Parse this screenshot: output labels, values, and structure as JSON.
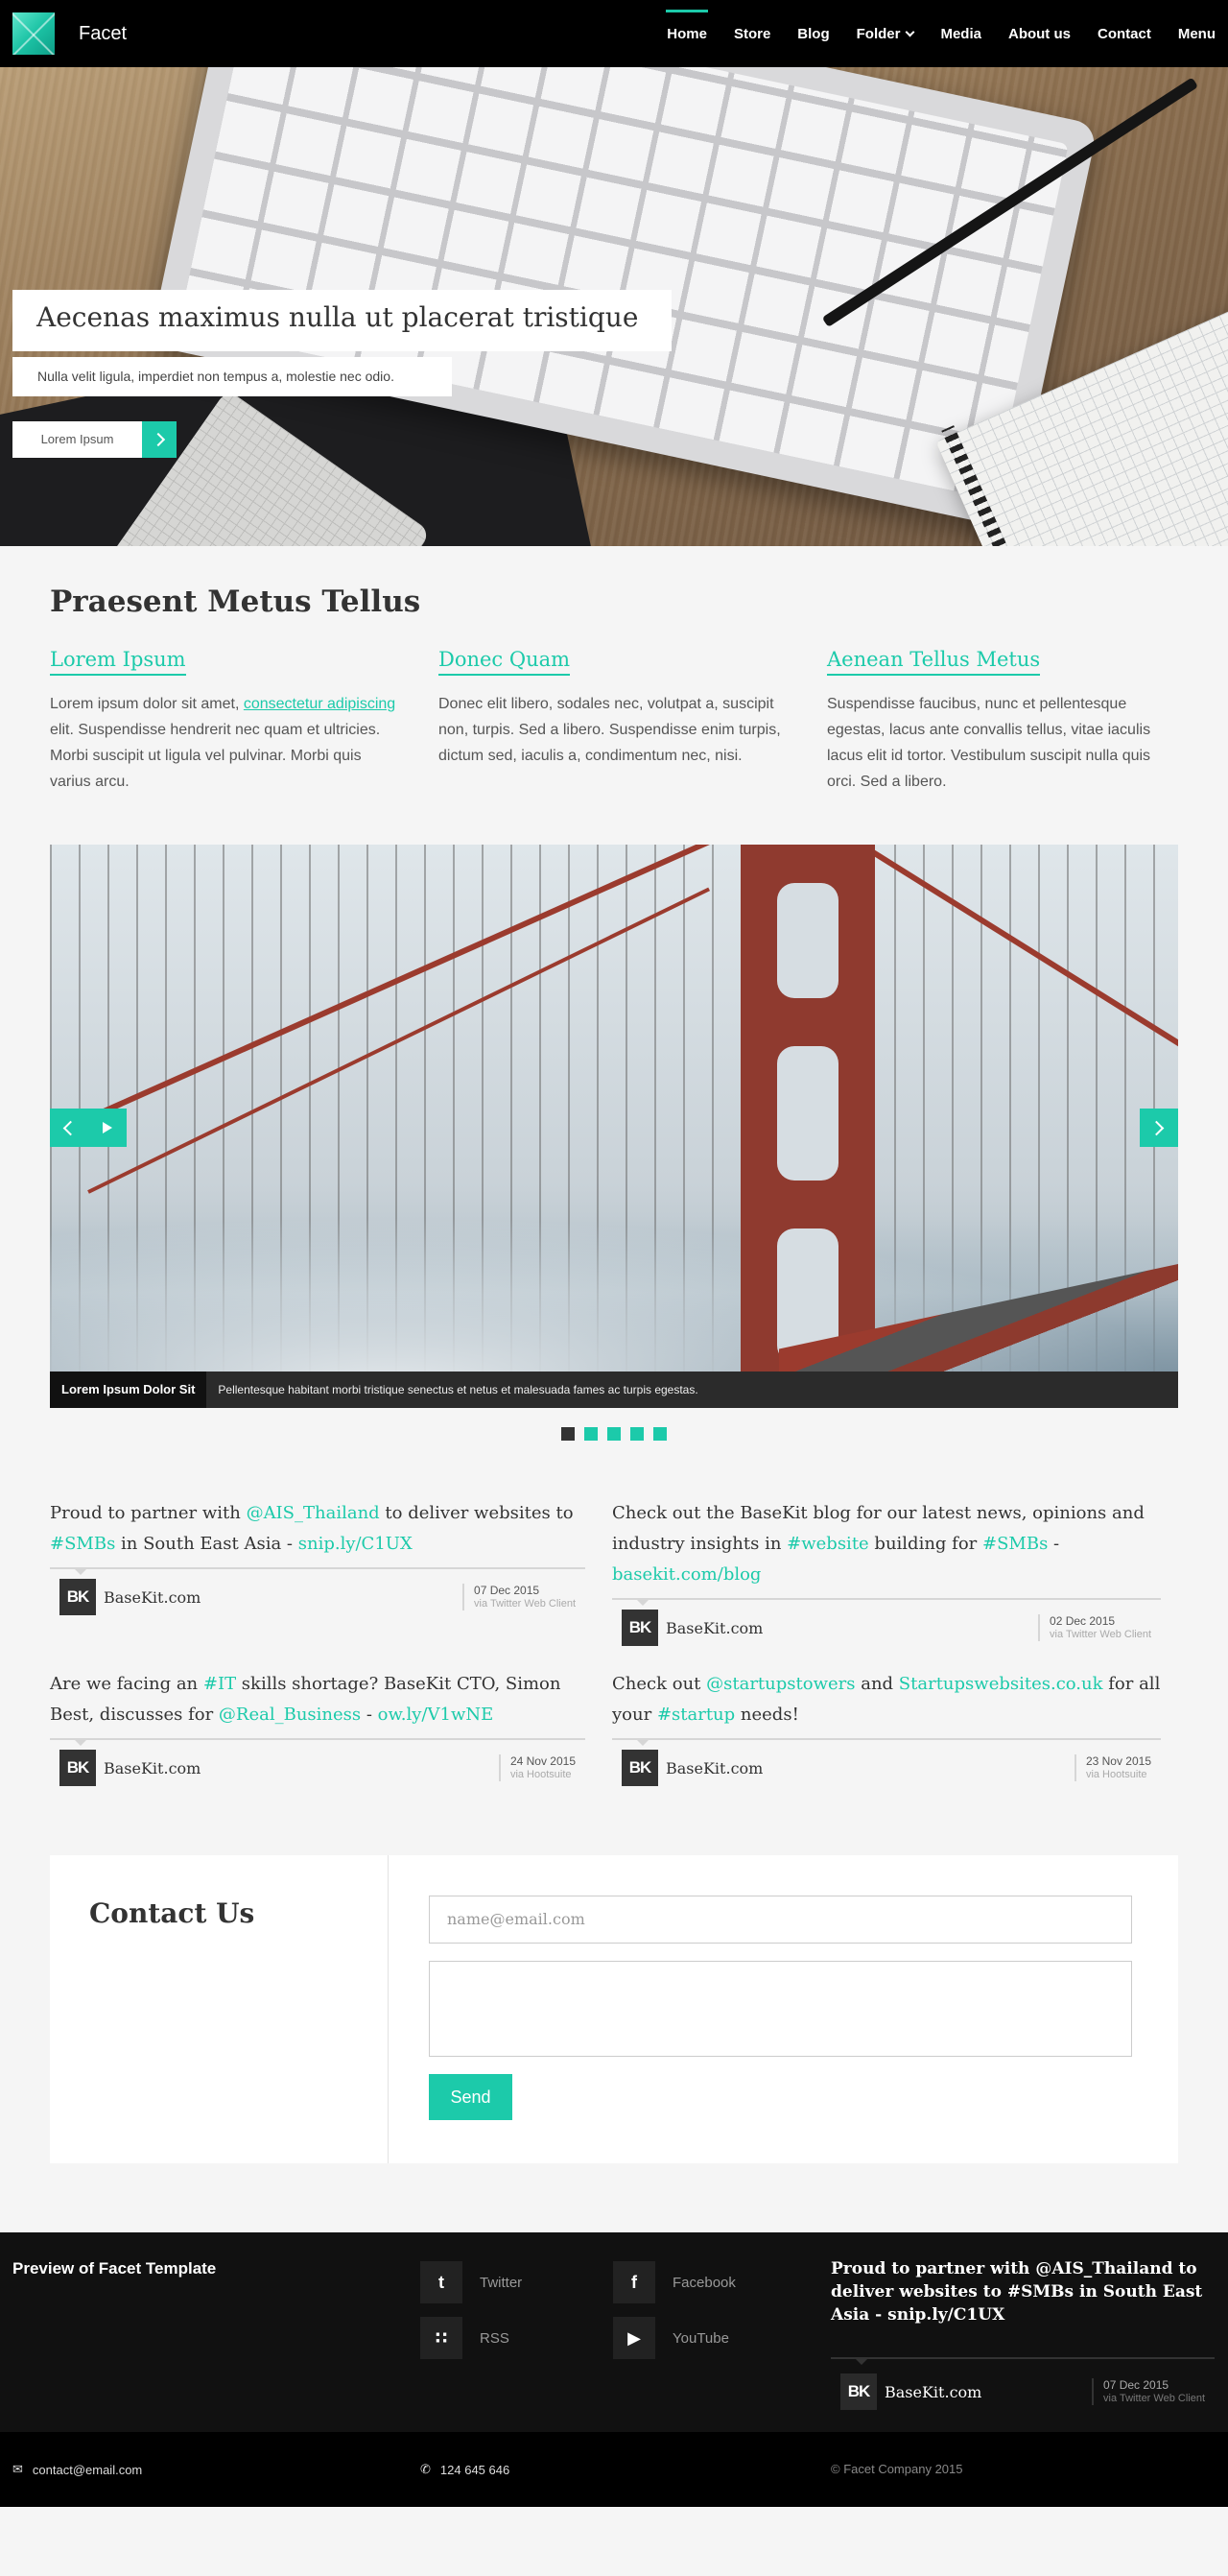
{
  "header": {
    "site_name": "Facet",
    "menu": [
      {
        "label": "Home",
        "active": true
      },
      {
        "label": "Store"
      },
      {
        "label": "Blog"
      },
      {
        "label": "Folder",
        "dropdown": true
      },
      {
        "label": "Media"
      },
      {
        "label": "About us"
      },
      {
        "label": "Contact"
      },
      {
        "label": "Menu"
      }
    ]
  },
  "hero": {
    "title": "Aecenas maximus nulla ut placerat tristique",
    "subtitle": "Nulla velit ligula, imperdiet non tempus a, molestie nec odio.",
    "button_label": "Lorem Ipsum"
  },
  "intro": {
    "title": "Praesent Metus Tellus",
    "columns": [
      {
        "title": "Lorem Ipsum",
        "text_before": "Lorem ipsum dolor sit amet, ",
        "link": "consectetur adipiscing",
        "text_after": " elit. Suspendisse hendrerit nec quam et ultricies. Morbi suscipit ut ligula vel pulvinar. Morbi quis varius arcu."
      },
      {
        "title": "Donec Quam",
        "text": "Donec elit libero, sodales nec, volutpat a, suscipit non, turpis. Sed a libero. Suspendisse enim turpis, dictum sed, iaculis a, condimentum nec, nisi."
      },
      {
        "title": "Aenean Tellus Metus",
        "text": "Suspendisse faucibus, nunc et pellentesque egestas, lacus ante convallis tellus, vitae iaculis lacus elit id tortor. Vestibulum suscipit nulla quis orci. Sed a libero."
      }
    ]
  },
  "slider": {
    "caption_title": "Lorem Ipsum Dolor Sit",
    "caption_text": "Pellentesque habitant morbi tristique senectus et netus et malesuada fames ac turpis egestas.",
    "slide_count": 5,
    "active_index": 0
  },
  "tweets": [
    {
      "parts": [
        [
          "Proud to partner with ",
          false
        ],
        [
          "@AIS_Thailand",
          true
        ],
        [
          " to deliver websites to ",
          false
        ],
        [
          "#SMBs",
          true
        ],
        [
          " in South East Asia - ",
          false
        ],
        [
          "snip.ly/C1UX",
          true
        ]
      ],
      "author": "BaseKit.com",
      "date": "07 Dec 2015",
      "via": "via Twitter Web Client"
    },
    {
      "parts": [
        [
          "Check out the BaseKit blog for our latest news, opinions and industry insights in ",
          false
        ],
        [
          "#website",
          true
        ],
        [
          " building for ",
          false
        ],
        [
          "#SMBs",
          true
        ],
        [
          " - ",
          false
        ],
        [
          "basekit.com/blog",
          true
        ]
      ],
      "author": "BaseKit.com",
      "date": "02 Dec 2015",
      "via": "via Twitter Web Client"
    },
    {
      "parts": [
        [
          "Are we facing an ",
          false
        ],
        [
          "#IT",
          true
        ],
        [
          " skills shortage? BaseKit CTO, Simon Best, discusses for ",
          false
        ],
        [
          "@Real_Business",
          true
        ],
        [
          " - ",
          false
        ],
        [
          "ow.ly/V1wNE",
          true
        ]
      ],
      "author": "BaseKit.com",
      "date": "24 Nov 2015",
      "via": "via Hootsuite"
    },
    {
      "parts": [
        [
          "Check out ",
          false
        ],
        [
          "@startupstowers",
          true
        ],
        [
          " and ",
          false
        ],
        [
          "Startupswebsites.co.uk",
          true
        ],
        [
          " for all your ",
          false
        ],
        [
          "#startup",
          true
        ],
        [
          " needs!",
          false
        ]
      ],
      "author": "BaseKit.com",
      "date": "23 Nov 2015",
      "via": "via Hootsuite"
    }
  ],
  "badge_text": "BK",
  "contact": {
    "title": "Contact Us",
    "email_placeholder": "name@email.com",
    "send_label": "Send"
  },
  "footer": {
    "title": "Preview of Facet Template",
    "social": [
      {
        "label": "Twitter",
        "icon": "twitter-icon",
        "glyph": "t"
      },
      {
        "label": "Facebook",
        "icon": "facebook-icon",
        "glyph": "f"
      },
      {
        "label": "RSS",
        "icon": "rss-icon",
        "glyph": "∷"
      },
      {
        "label": "YouTube",
        "icon": "youtube-icon",
        "glyph": "▶"
      }
    ],
    "tweet_parts": [
      [
        "Proud to partner with ",
        false
      ],
      [
        "@AIS_Thailand",
        true
      ],
      [
        " to deliver websites to ",
        false
      ],
      [
        "#SMBs",
        true
      ],
      [
        " in South East Asia - ",
        false
      ],
      [
        "snip.ly/C1UX",
        true
      ]
    ],
    "tweet_author": "BaseKit.com",
    "tweet_date": "07 Dec 2015",
    "tweet_via": "via Twitter Web Client"
  },
  "bottom": {
    "email": "contact@email.com",
    "phone": "124 645 646",
    "copyright": "© Facet Company 2015"
  },
  "colors": {
    "accent": "#1ccaaa",
    "nav_bg": "#000000",
    "footer_bg": "#111111"
  }
}
